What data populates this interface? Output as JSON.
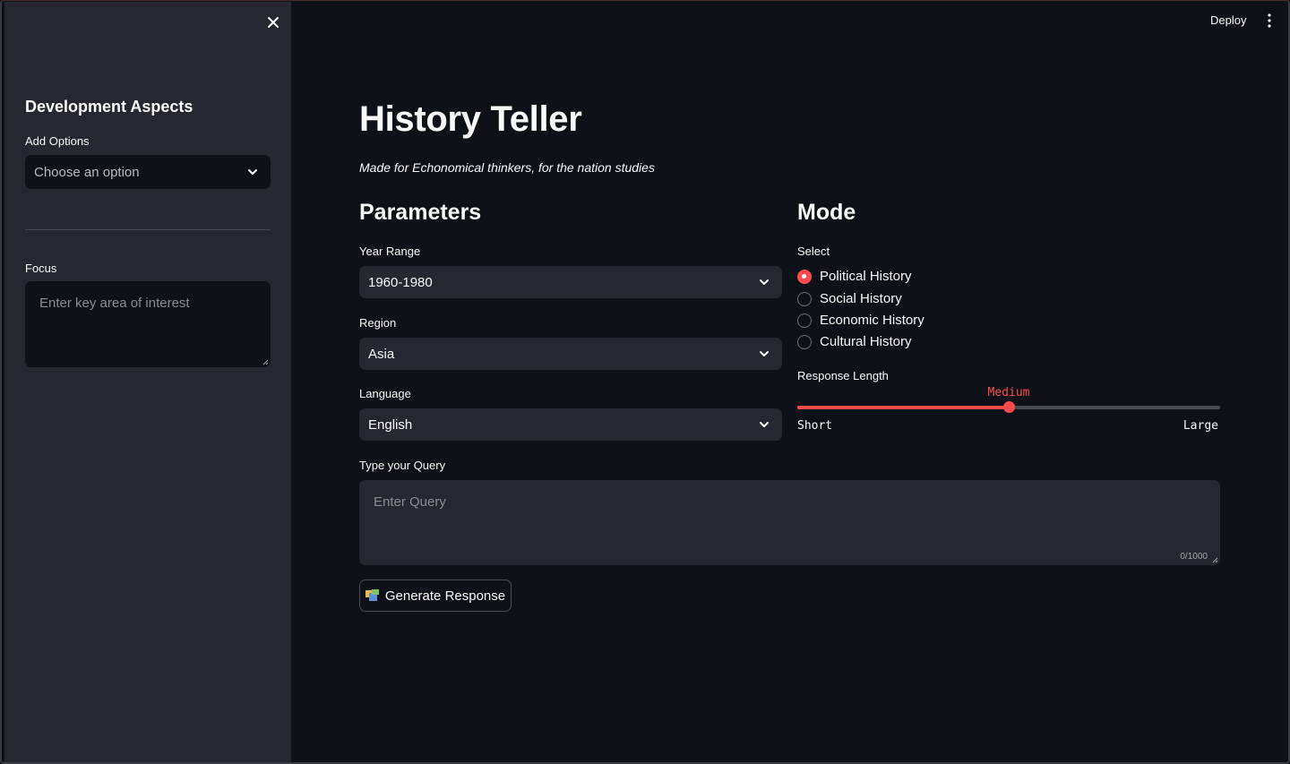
{
  "header": {
    "deploy_label": "Deploy"
  },
  "sidebar": {
    "title": "Development Aspects",
    "add_options_label": "Add Options",
    "add_options_placeholder": "Choose an option",
    "focus_label": "Focus",
    "focus_placeholder": "Enter key area of interest"
  },
  "main": {
    "title": "History Teller",
    "subtitle": "Made for Echonomical thinkers, for the nation studies",
    "parameters": {
      "heading": "Parameters",
      "year_range": {
        "label": "Year Range",
        "value": "1960-1980"
      },
      "region": {
        "label": "Region",
        "value": "Asia"
      },
      "language": {
        "label": "Language",
        "value": "English"
      }
    },
    "mode": {
      "heading": "Mode",
      "select_label": "Select",
      "options": [
        {
          "label": "Political History",
          "selected": true
        },
        {
          "label": "Social History",
          "selected": false
        },
        {
          "label": "Economic History",
          "selected": false
        },
        {
          "label": "Cultural History",
          "selected": false
        }
      ],
      "response_length": {
        "label": "Response Length",
        "value": "Medium",
        "min_label": "Short",
        "max_label": "Large",
        "fraction": 0.5
      }
    },
    "query": {
      "label": "Type your Query",
      "placeholder": "Enter Query",
      "counter": "0/1000"
    },
    "generate_label": "Generate Response"
  },
  "colors": {
    "accent": "#ff4b4b",
    "background": "#0e1117",
    "sidebar": "#262730"
  }
}
